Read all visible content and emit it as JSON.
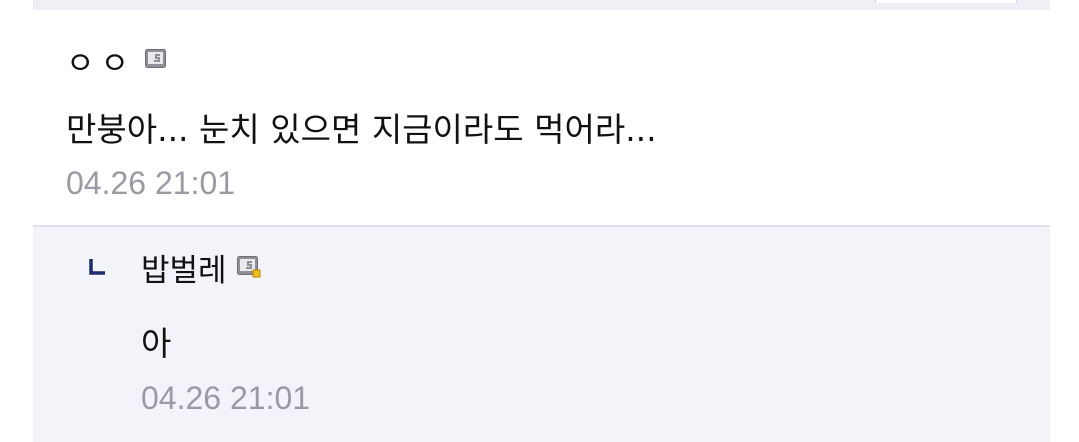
{
  "comment": {
    "nickname": "ㅇㅇ",
    "gallog_icon": "gallog-icon",
    "text": "만붕아... 눈치 있으면 지금이라도 먹어라...",
    "timestamp": "04.26 21:01"
  },
  "reply": {
    "marker_icon": "reply-corner-icon",
    "nickname": "밥벌레",
    "gallog_icon": "gallog-fixed-icon",
    "text": "아",
    "timestamp": "04.26 21:01"
  },
  "colors": {
    "reply_background": "#f3f4f9",
    "timestamp": "#9a9aa3",
    "reply_marker": "#1f2a6b",
    "fixed_badge": "#f0c020"
  }
}
